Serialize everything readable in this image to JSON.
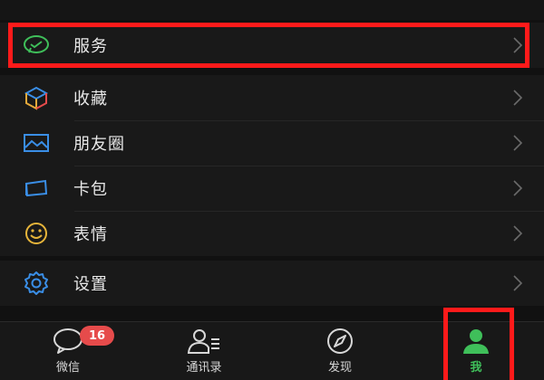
{
  "menu": {
    "service": {
      "label": "服务",
      "icon": "wechat-pay-icon"
    },
    "items": [
      {
        "label": "收藏",
        "icon": "cube-icon"
      },
      {
        "label": "朋友圈",
        "icon": "picture-icon"
      },
      {
        "label": "卡包",
        "icon": "card-icon"
      },
      {
        "label": "表情",
        "icon": "smiley-icon"
      }
    ],
    "settings": {
      "label": "设置",
      "icon": "gear-icon"
    }
  },
  "tabbar": {
    "tabs": [
      {
        "label": "微信",
        "icon": "chat-bubble-icon",
        "badge": "16"
      },
      {
        "label": "通讯录",
        "icon": "contacts-icon"
      },
      {
        "label": "发现",
        "icon": "compass-icon"
      },
      {
        "label": "我",
        "icon": "person-icon",
        "active": true
      }
    ]
  },
  "colors": {
    "background": "#111111",
    "accent_green": "#3fbf5a",
    "highlight_red": "#ff1a1a",
    "badge_red": "#e64b4b"
  }
}
